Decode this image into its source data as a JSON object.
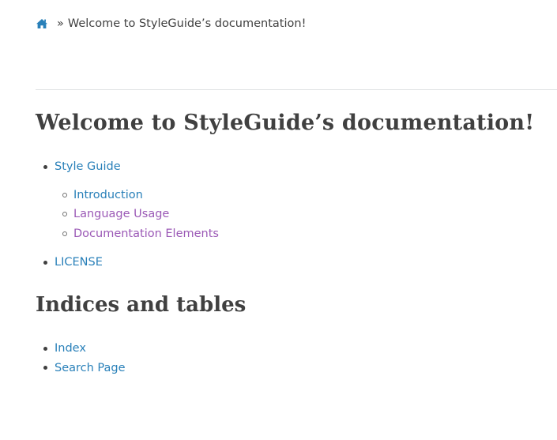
{
  "breadcrumb": {
    "home_icon": "home-icon",
    "separator": "»",
    "current": "Welcome to StyleGuide’s documentation!"
  },
  "title": "Welcome to StyleGuide’s documentation!",
  "toc": {
    "items": [
      {
        "label": "Style Guide",
        "children": [
          {
            "label": "Introduction"
          },
          {
            "label": "Language Usage"
          },
          {
            "label": "Documentation Elements"
          }
        ]
      },
      {
        "label": "LICENSE"
      }
    ]
  },
  "indices": {
    "heading": "Indices and tables",
    "items": [
      {
        "label": "Index"
      },
      {
        "label": "Search Page"
      }
    ]
  },
  "colors": {
    "link": "#2980b9",
    "visited_link": "#9b59b6",
    "text": "#404040",
    "divider": "#e1e4e5"
  }
}
